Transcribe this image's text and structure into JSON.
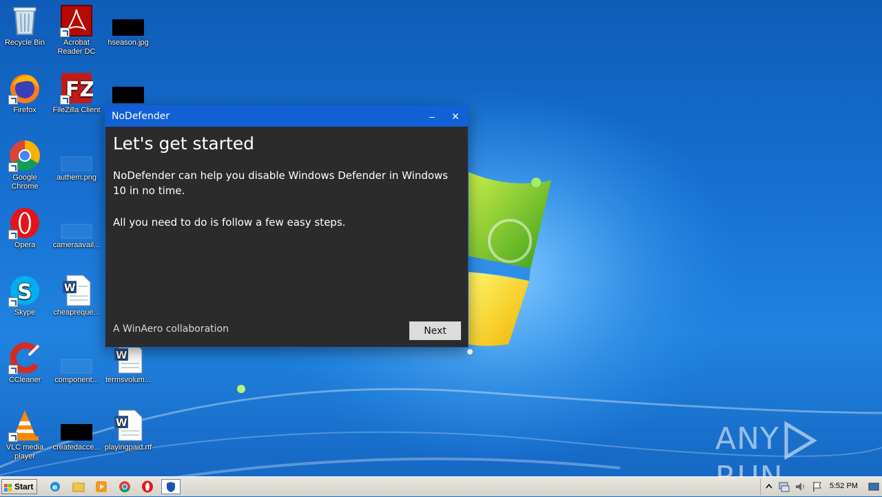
{
  "desktop": {
    "icons": [
      {
        "label": "Recycle Bin"
      },
      {
        "label": "Acrobat Reader DC"
      },
      {
        "label": "hseason.jpg"
      },
      {
        "label": "Firefox"
      },
      {
        "label": "FileZilla Client"
      },
      {
        "label": "Google Chrome"
      },
      {
        "label": "authem.png"
      },
      {
        "label": "Opera"
      },
      {
        "label": "cameraavail..."
      },
      {
        "label": "Skype"
      },
      {
        "label": "cheapreque..."
      },
      {
        "label": "CCleaner"
      },
      {
        "label": "component..."
      },
      {
        "label": "termsvolum..."
      },
      {
        "label": "VLC media player"
      },
      {
        "label": "createdacce..."
      },
      {
        "label": "playingpaid.rtf"
      }
    ]
  },
  "dialog": {
    "title": "NoDefender",
    "minimize_glyph": "–",
    "close_glyph": "✕",
    "heading": "Let's get started",
    "paragraph1": "NoDefender can help you disable Windows Defender in Windows 10 in no time.",
    "paragraph2": "All you need to do is follow a few easy steps.",
    "footer": "A WinAero collaboration",
    "next_label": "Next"
  },
  "watermark": {
    "left": "ANY",
    "right": "RUN"
  },
  "taskbar": {
    "start_label": "Start",
    "clock": "5:52 PM"
  },
  "colors": {
    "titlebar": "#1160d6",
    "dialog_bg": "#2b2b2b",
    "button_bg": "#dcdcdc"
  }
}
